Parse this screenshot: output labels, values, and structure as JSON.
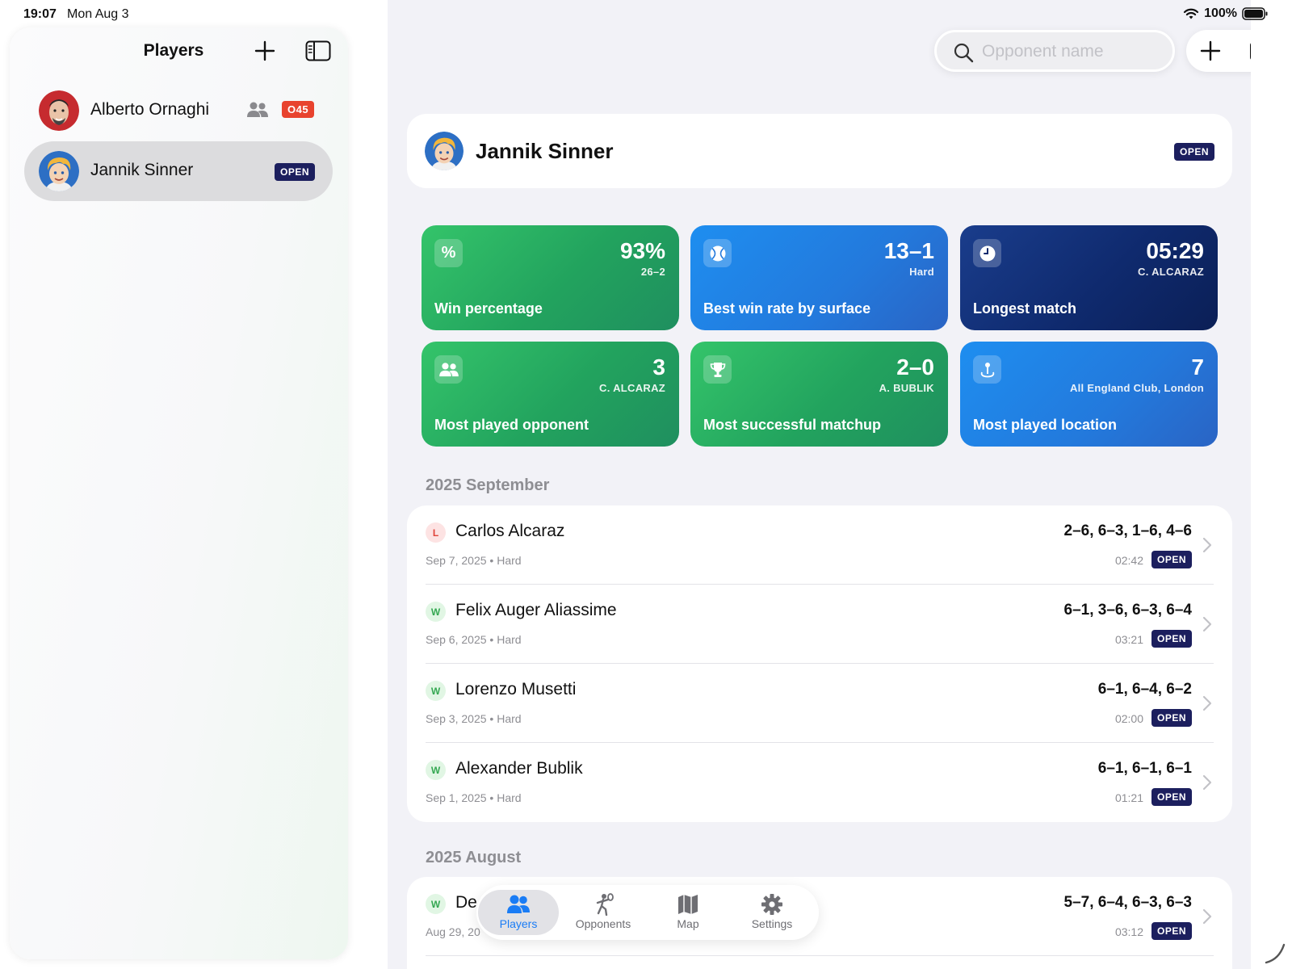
{
  "status": {
    "time": "19:07",
    "date": "Mon Aug 3",
    "battery": "100%"
  },
  "sidebar": {
    "title": "Players",
    "players": [
      {
        "name": "Alberto Ornaghi",
        "badge": "O45",
        "selected": false
      },
      {
        "name": "Jannik Sinner",
        "badge": "OPEN",
        "selected": true
      }
    ]
  },
  "search": {
    "placeholder": "Opponent name",
    "value": ""
  },
  "header": {
    "name": "Jannik Sinner",
    "badge": "OPEN"
  },
  "stats": [
    {
      "icon": "percent-icon",
      "value": "93%",
      "sub": "26–2",
      "label": "Win percentage",
      "color": "green"
    },
    {
      "icon": "tennis-ball-icon",
      "value": "13–1",
      "sub": "Hard",
      "label": "Best win rate by surface",
      "color": "blue"
    },
    {
      "icon": "clock-icon",
      "value": "05:29",
      "sub": "C. ALCARAZ",
      "label": "Longest match",
      "color": "navy"
    },
    {
      "icon": "people-icon",
      "value": "3",
      "sub": "C. ALCARAZ",
      "label": "Most played opponent",
      "color": "green"
    },
    {
      "icon": "trophy-icon",
      "value": "2–0",
      "sub": "A. BUBLIK",
      "label": "Most successful matchup",
      "color": "green"
    },
    {
      "icon": "location-pin-icon",
      "value": "7",
      "sub": "All England Club, London",
      "label": "Most played location",
      "color": "blue"
    }
  ],
  "sections": [
    {
      "title": "2025 September",
      "matches": [
        {
          "result": "L",
          "opponent": "Carlos Alcaraz",
          "date": "Sep 7, 2025",
          "surface": "Hard",
          "score": "2–6, 6–3, 1–6, 4–6",
          "duration": "02:42",
          "badge": "OPEN"
        },
        {
          "result": "W",
          "opponent": "Felix Auger Aliassime",
          "date": "Sep 6, 2025",
          "surface": "Hard",
          "score": "6–1, 3–6, 6–3, 6–4",
          "duration": "03:21",
          "badge": "OPEN"
        },
        {
          "result": "W",
          "opponent": "Lorenzo Musetti",
          "date": "Sep 3, 2025",
          "surface": "Hard",
          "score": "6–1, 6–4, 6–2",
          "duration": "02:00",
          "badge": "OPEN"
        },
        {
          "result": "W",
          "opponent": "Alexander Bublik",
          "date": "Sep 1, 2025",
          "surface": "Hard",
          "score": "6–1, 6–1, 6–1",
          "duration": "01:21",
          "badge": "OPEN"
        }
      ]
    },
    {
      "title": "2025 August",
      "matches": [
        {
          "result": "W",
          "opponent": "De",
          "date": "Aug 29, 20",
          "surface": "",
          "score": "5–7, 6–4, 6–3, 6–3",
          "duration": "03:12",
          "badge": "OPEN"
        }
      ]
    }
  ],
  "tabs": [
    {
      "label": "Players",
      "icon": "people-icon",
      "active": true
    },
    {
      "label": "Opponents",
      "icon": "tennis-player-icon",
      "active": false
    },
    {
      "label": "Map",
      "icon": "map-icon",
      "active": false
    },
    {
      "label": "Settings",
      "icon": "gear-icon",
      "active": false
    }
  ],
  "colors": {
    "accent": "#1a7cf5",
    "badge_navy": "#1c1f5e",
    "badge_red": "#e8432e"
  }
}
